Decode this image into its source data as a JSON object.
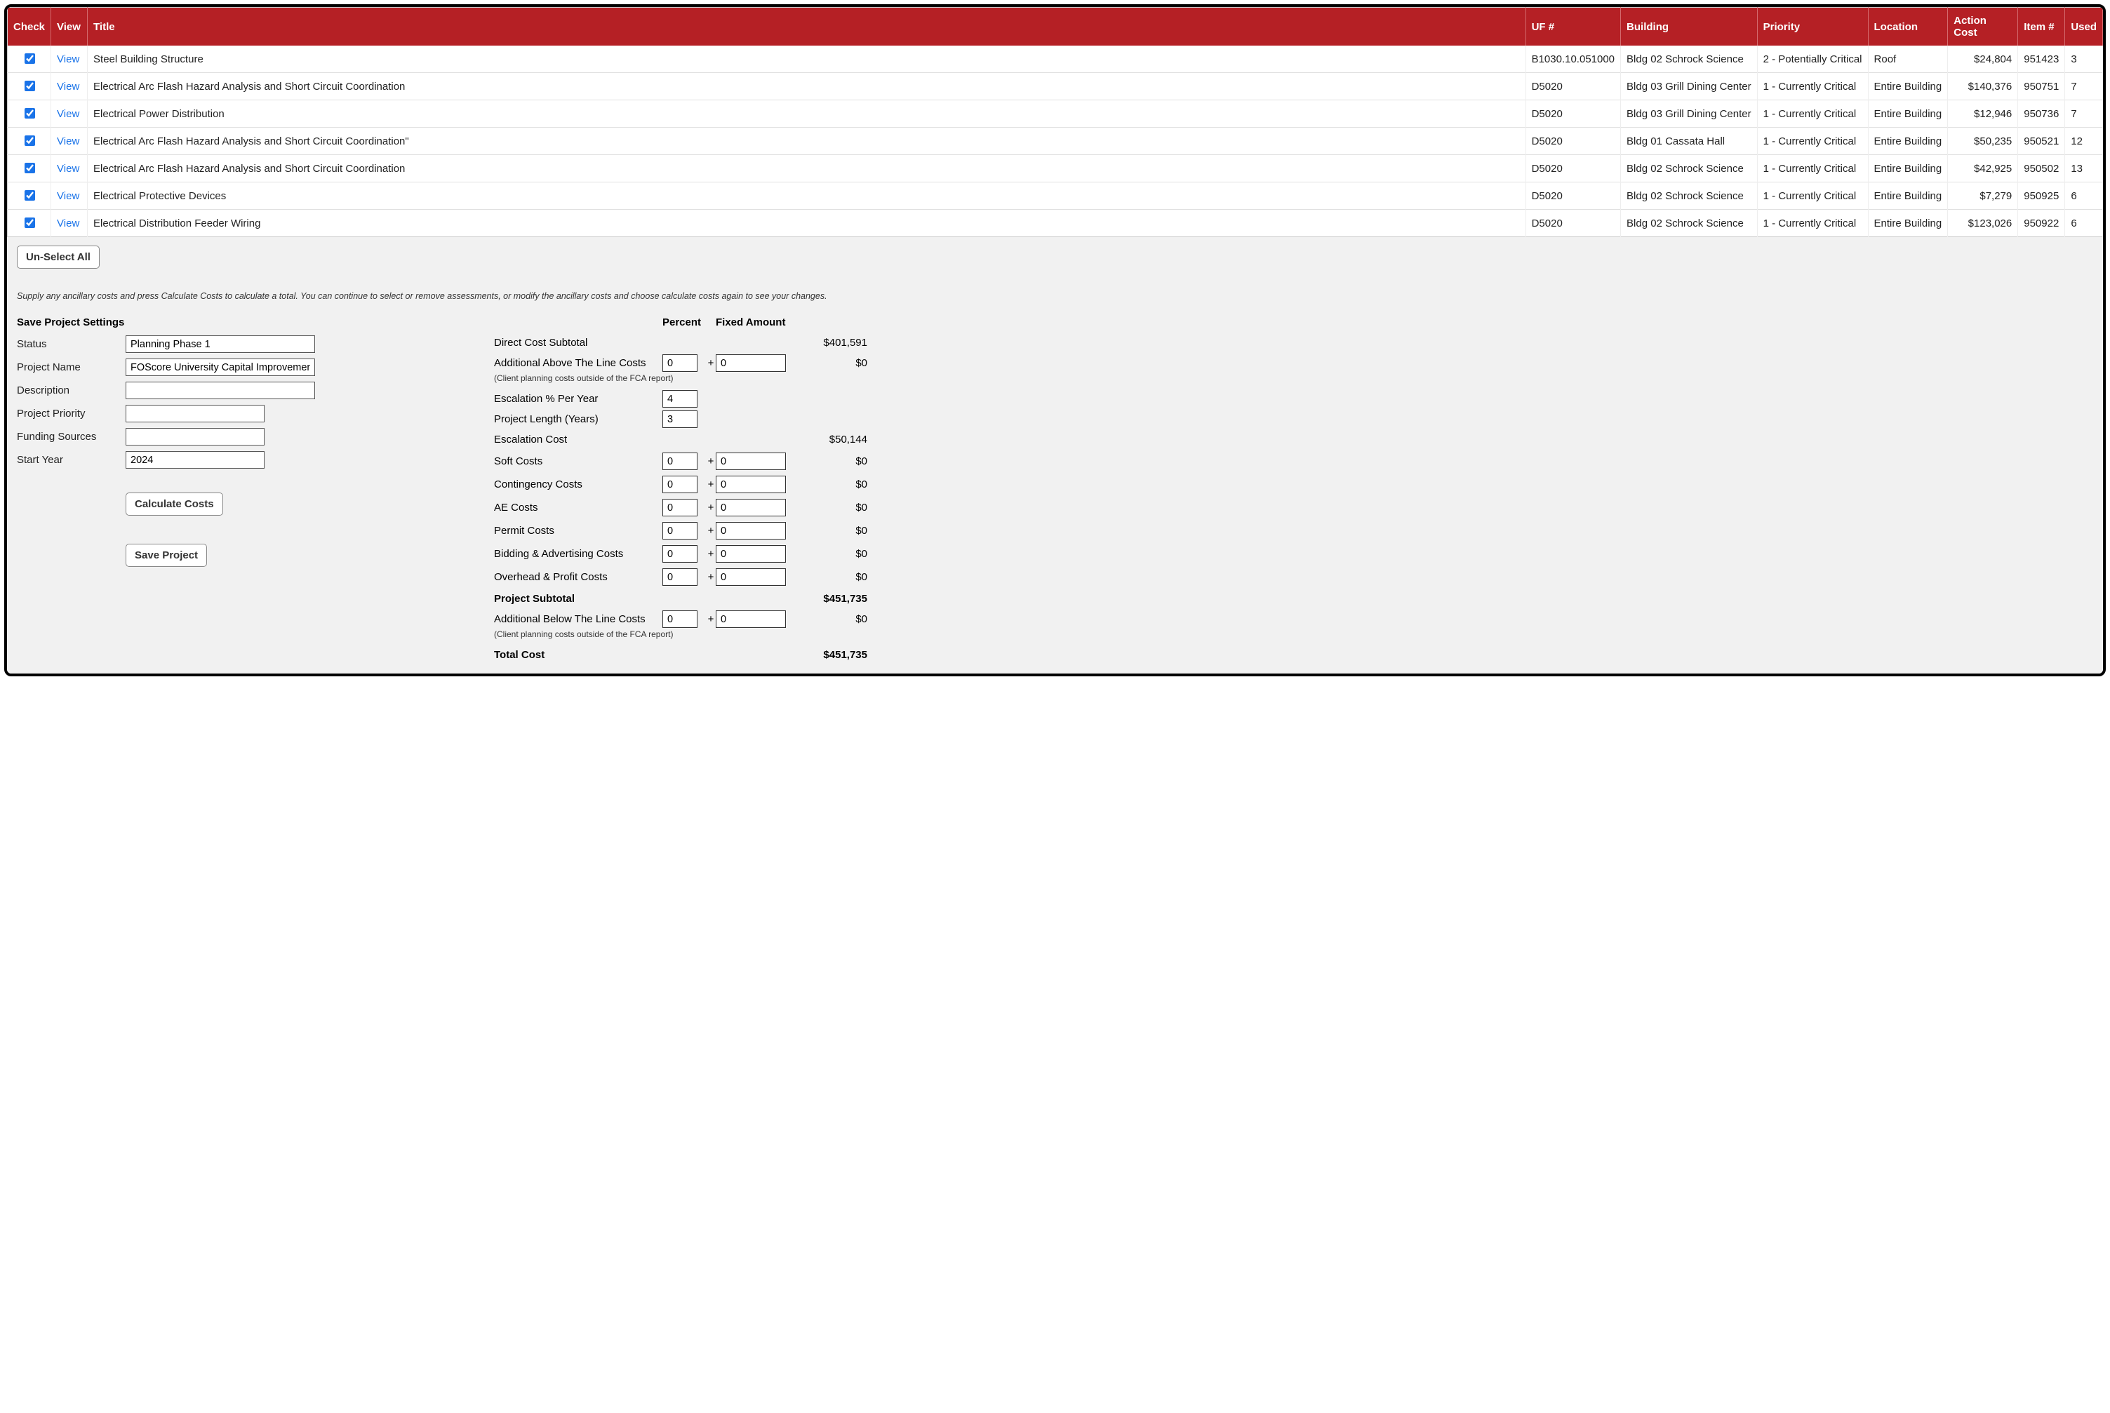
{
  "table": {
    "headers": {
      "check": "Check",
      "view": "View",
      "title": "Title",
      "uf": "UF #",
      "building": "Building",
      "priority": "Priority",
      "location": "Location",
      "action_cost": "Action Cost",
      "item": "Item #",
      "used": "Used"
    },
    "rows": [
      {
        "checked": true,
        "view": "View",
        "title": "Steel Building Structure",
        "uf": "B1030.10.051000",
        "building": "Bldg 02 Schrock Science",
        "priority": "2 - Potentially Critical",
        "location": "Roof",
        "action_cost": "$24,804",
        "item": "951423",
        "used": "3"
      },
      {
        "checked": true,
        "view": "View",
        "title": "Electrical Arc Flash Hazard Analysis and Short Circuit Coordination",
        "uf": "D5020",
        "building": "Bldg 03 Grill Dining Center",
        "priority": "1 - Currently Critical",
        "location": "Entire Building",
        "action_cost": "$140,376",
        "item": "950751",
        "used": "7"
      },
      {
        "checked": true,
        "view": "View",
        "title": "Electrical Power Distribution",
        "uf": "D5020",
        "building": "Bldg 03 Grill Dining Center",
        "priority": "1 - Currently Critical",
        "location": "Entire Building",
        "action_cost": "$12,946",
        "item": "950736",
        "used": "7"
      },
      {
        "checked": true,
        "view": "View",
        "title": "Electrical Arc Flash Hazard Analysis and Short Circuit Coordination\"",
        "uf": "D5020",
        "building": "Bldg 01 Cassata Hall",
        "priority": "1 - Currently Critical",
        "location": "Entire Building",
        "action_cost": "$50,235",
        "item": "950521",
        "used": "12"
      },
      {
        "checked": true,
        "view": "View",
        "title": "Electrical Arc Flash Hazard Analysis and Short Circuit Coordination",
        "uf": "D5020",
        "building": "Bldg 02 Schrock Science",
        "priority": "1 - Currently Critical",
        "location": "Entire Building",
        "action_cost": "$42,925",
        "item": "950502",
        "used": "13"
      },
      {
        "checked": true,
        "view": "View",
        "title": "Electrical Protective Devices",
        "uf": "D5020",
        "building": "Bldg 02 Schrock Science",
        "priority": "1 - Currently Critical",
        "location": "Entire Building",
        "action_cost": "$7,279",
        "item": "950925",
        "used": "6"
      },
      {
        "checked": true,
        "view": "View",
        "title": "Electrical Distribution Feeder Wiring",
        "uf": "D5020",
        "building": "Bldg 02 Schrock Science",
        "priority": "1 - Currently Critical",
        "location": "Entire Building",
        "action_cost": "$123,026",
        "item": "950922",
        "used": "6"
      }
    ]
  },
  "buttons": {
    "unselect_all": "Un-Select All",
    "calculate": "Calculate Costs",
    "save_project": "Save Project"
  },
  "instructions": "Supply any ancillary costs and press Calculate Costs to calculate a total.  You can continue to select or remove assessments, or modify the ancillary costs and choose calculate costs again to see your changes.",
  "settings": {
    "heading": "Save Project Settings",
    "labels": {
      "status": "Status",
      "project_name": "Project Name",
      "description": "Description",
      "priority": "Project Priority",
      "funding": "Funding Sources",
      "start_year": "Start Year"
    },
    "values": {
      "status": "Planning Phase 1",
      "project_name": "FOScore University Capital Improvement",
      "description": "",
      "priority": "",
      "funding": "",
      "start_year": "2024"
    }
  },
  "costs": {
    "headers": {
      "percent": "Percent",
      "fixed": "Fixed Amount"
    },
    "direct_subtotal_label": "Direct Cost Subtotal",
    "direct_subtotal": "$401,591",
    "above_line_label": "Additional Above The Line Costs",
    "above_line_pct": "0",
    "above_line_fix": "0",
    "above_line_amt": "$0",
    "note1": "(Client planning costs outside of the FCA report)",
    "escalation_pct_label": "Escalation % Per Year",
    "escalation_pct": "4",
    "project_length_label": "Project Length (Years)",
    "project_length": "3",
    "escalation_cost_label": "Escalation Cost",
    "escalation_cost": "$50,144",
    "soft_label": "Soft Costs",
    "soft_pct": "0",
    "soft_fix": "0",
    "soft_amt": "$0",
    "cont_label": "Contingency Costs",
    "cont_pct": "0",
    "cont_fix": "0",
    "cont_amt": "$0",
    "ae_label": "AE Costs",
    "ae_pct": "0",
    "ae_fix": "0",
    "ae_amt": "$0",
    "permit_label": "Permit Costs",
    "permit_pct": "0",
    "permit_fix": "0",
    "permit_amt": "$0",
    "bid_label": "Bidding & Advertising Costs",
    "bid_pct": "0",
    "bid_fix": "0",
    "bid_amt": "$0",
    "oh_label": "Overhead & Profit Costs",
    "oh_pct": "0",
    "oh_fix": "0",
    "oh_amt": "$0",
    "subtotal_label": "Project Subtotal",
    "subtotal": "$451,735",
    "below_line_label": "Additional Below The Line Costs",
    "below_line_pct": "0",
    "below_line_fix": "0",
    "below_line_amt": "$0",
    "note2": "(Client planning costs outside of the FCA report)",
    "total_label": "Total Cost",
    "total": "$451,735",
    "plus": "+"
  }
}
